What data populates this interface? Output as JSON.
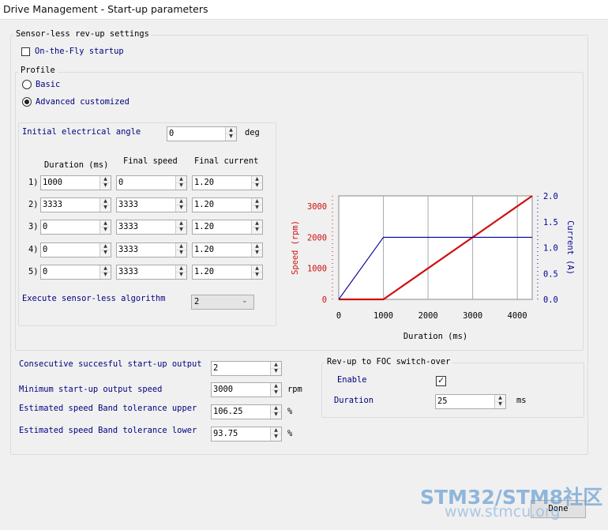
{
  "window": {
    "title": "Drive Management - Start-up parameters"
  },
  "sensorless": {
    "group_label": "Sensor-less rev-up settings",
    "on_the_fly_label": "On-the-Fly startup",
    "on_the_fly_checked": false
  },
  "profile": {
    "group_label": "Profile",
    "basic_label": "Basic",
    "advanced_label": "Advanced customized",
    "selected": "Advanced customized"
  },
  "angle": {
    "label": "Initial electrical angle",
    "value": "0",
    "unit": "deg"
  },
  "table": {
    "headers": [
      "Duration (ms)",
      "Final speed",
      "Final current"
    ],
    "rows": [
      {
        "index": "1)",
        "duration": "1000",
        "speed": "0",
        "current": "1.20"
      },
      {
        "index": "2)",
        "duration": "3333",
        "speed": "3333",
        "current": "1.20"
      },
      {
        "index": "3)",
        "duration": "0",
        "speed": "3333",
        "current": "1.20"
      },
      {
        "index": "4)",
        "duration": "0",
        "speed": "3333",
        "current": "1.20"
      },
      {
        "index": "5)",
        "duration": "0",
        "speed": "3333",
        "current": "1.20"
      }
    ]
  },
  "execute": {
    "label": "Execute sensor-less algorithm",
    "value": "2"
  },
  "consecutive": {
    "label": "Consecutive succesful start-up output",
    "value": "2"
  },
  "min_speed": {
    "label": "Minimum start-up output speed",
    "value": "3000",
    "unit": "rpm"
  },
  "band_upper": {
    "label": "Estimated speed Band tolerance upper",
    "value": "106.25",
    "unit": "%"
  },
  "band_lower": {
    "label": "Estimated speed Band tolerance lower",
    "value": "93.75",
    "unit": "%"
  },
  "switchover": {
    "group_label": "Rev-up to FOC switch-over",
    "enable_label": "Enable",
    "enable_checked": true,
    "duration_label": "Duration",
    "duration_value": "25",
    "duration_unit": "ms"
  },
  "buttons": {
    "done": "Done"
  },
  "watermark": {
    "main": "STM32/STM8社区",
    "sub": "www.stmcu.org"
  },
  "colors": {
    "speed": "#cc1111",
    "current": "#000099",
    "label_blue": "#000080"
  },
  "chart_data": {
    "type": "line",
    "xlabel": "Duration (ms)",
    "ylabel": "Speed (rpm)",
    "y2label": "Current (A)",
    "xlim": [
      0,
      4333
    ],
    "ylim": [
      0,
      3333
    ],
    "y2lim": [
      0,
      2.0
    ],
    "x_ticks": [
      "0",
      "1000",
      "2000",
      "3000",
      "4000"
    ],
    "y_ticks": [
      "0",
      "1000",
      "2000",
      "3000"
    ],
    "y2_ticks": [
      "0.0",
      "0.5",
      "1.0",
      "1.5",
      "2.0"
    ],
    "grid": true,
    "series": [
      {
        "name": "Speed",
        "axis": "left",
        "color": "#cc1111",
        "x": [
          0,
          1000,
          4333
        ],
        "y": [
          0,
          0,
          3333
        ]
      },
      {
        "name": "Current",
        "axis": "right",
        "color": "#000099",
        "x": [
          0,
          1000,
          4333
        ],
        "y": [
          0,
          1.2,
          1.2
        ]
      }
    ]
  }
}
